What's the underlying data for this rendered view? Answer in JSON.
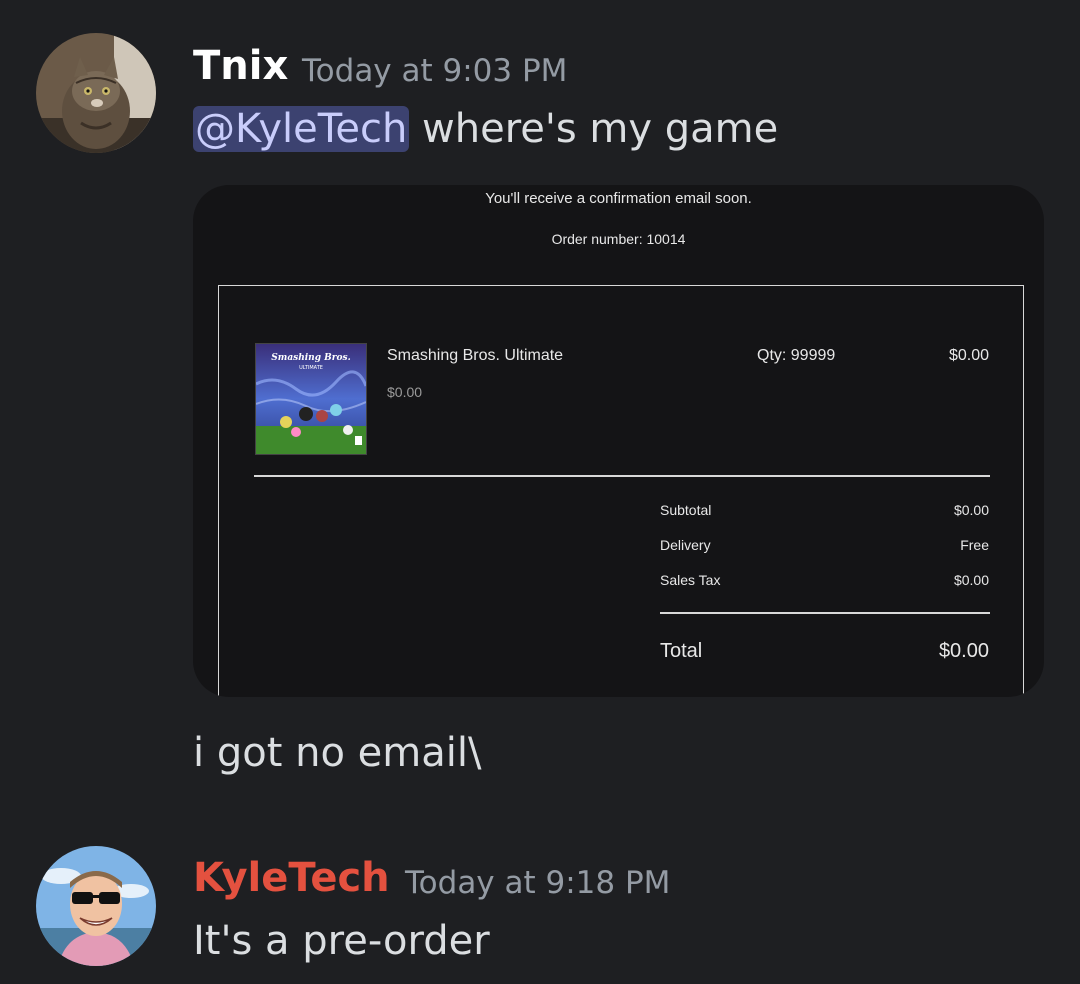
{
  "messages": [
    {
      "username": "Tnix",
      "username_color": "#ffffff",
      "timestamp": "Today at 9:03 PM",
      "mention": "@KyleTech",
      "text": " where's my game",
      "followup_text": "i got no email\\",
      "avatar_icon": "cat-avatar-icon"
    },
    {
      "username": "KyleTech",
      "username_color": "#e4513f",
      "timestamp": "Today at 9:18 PM",
      "text": "It's a pre-order",
      "avatar_icon": "person-sunglasses-avatar-icon"
    }
  ],
  "order": {
    "confirmation": "You'll receive a confirmation email soon.",
    "order_number": "Order number: 10014",
    "item": {
      "name": "Smashing Bros. Ultimate",
      "unit_price": "$0.00",
      "qty": "Qty: 99999",
      "line_total": "$0.00",
      "cover_title": "Smashing Bros.",
      "cover_subtitle": "ULTIMATE"
    },
    "summary": {
      "subtotal_label": "Subtotal",
      "subtotal_value": "$0.00",
      "delivery_label": "Delivery",
      "delivery_value": "Free",
      "tax_label": "Sales Tax",
      "tax_value": "$0.00",
      "total_label": "Total",
      "total_value": "$0.00"
    }
  }
}
